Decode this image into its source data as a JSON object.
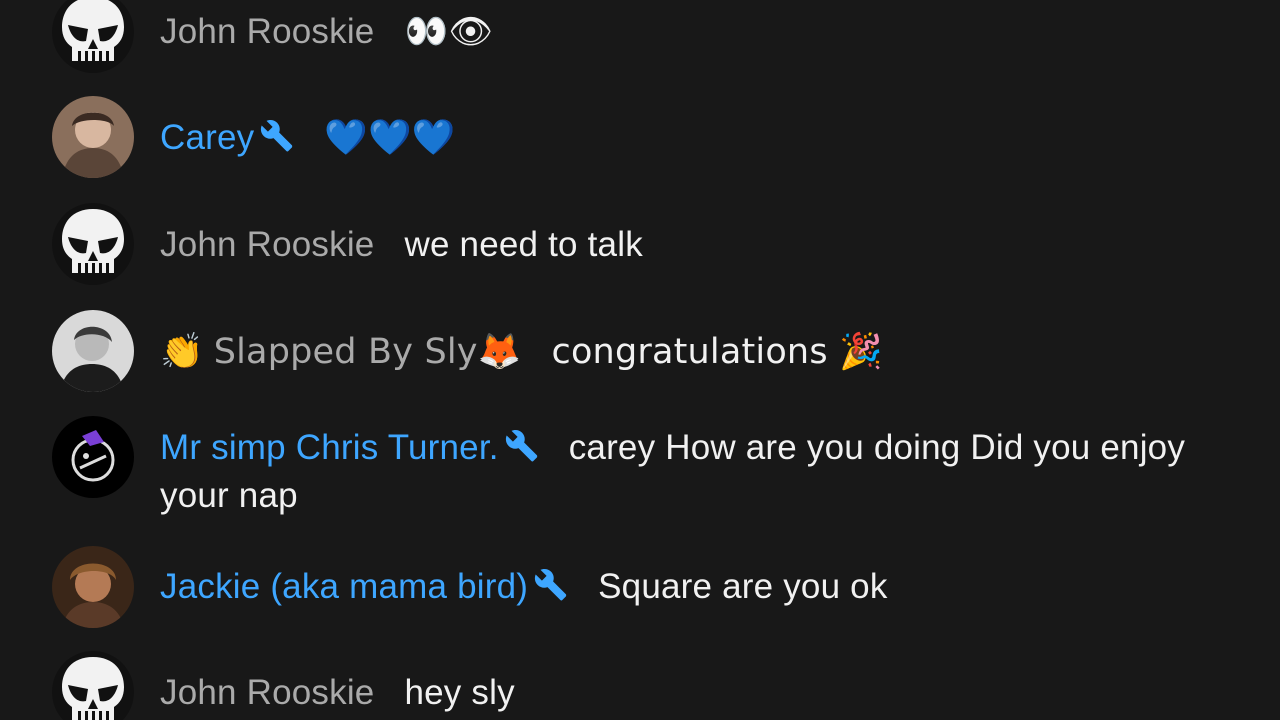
{
  "messages": [
    {
      "author": "John Rooskie",
      "text": "👀👁",
      "moderator": false,
      "avatar": "punisher-skull"
    },
    {
      "author": "Carey",
      "text": "💙💙💙",
      "moderator": true,
      "avatar": "photo-carey"
    },
    {
      "author": "John Rooskie",
      "text": "we need to talk",
      "moderator": false,
      "avatar": "punisher-skull"
    },
    {
      "author_prefix": "👏",
      "author": "Slapped By Sly🦊",
      "text": "congratulations 🎉",
      "moderator": false,
      "avatar": "photo-sly"
    },
    {
      "author": "Mr simp Chris Turner.",
      "text": "carey How are you doing Did you enjoy your nap",
      "moderator": true,
      "avatar": "graphic-chris"
    },
    {
      "author": "Jackie (aka mama bird)",
      "text": "Square are you ok",
      "moderator": true,
      "avatar": "photo-jackie"
    },
    {
      "author": "John Rooskie",
      "text": "hey sly",
      "moderator": false,
      "avatar": "punisher-skull"
    }
  ],
  "colors": {
    "background": "#181818",
    "author": "#aaaaaa",
    "moderator": "#3ea6ff",
    "text": "#f1f1f1"
  }
}
